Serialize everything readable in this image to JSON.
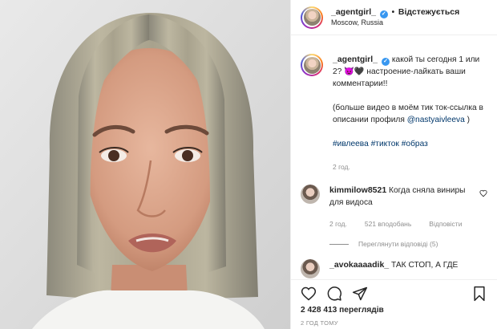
{
  "header": {
    "username": "_agentgirl_",
    "verified_badge": "✓",
    "separator": "•",
    "follow_state": "Відстежується",
    "location": "Moscow, Russia"
  },
  "caption": {
    "username": "_agentgirl_",
    "line1": "какой ты сегодня 1 или 2? 😈🖤 настроение-лайкать ваши комментарии!!",
    "line2": "(больше видео в моём тик ток-ссылка в описании профиля",
    "mention": "@nastyaivleeva",
    "line2_end": ")",
    "hashtags": [
      "#ивлеева",
      "#тикток",
      "#образ"
    ],
    "time": "2 год."
  },
  "comments": [
    {
      "username": "kimmilow8521",
      "text": "Когда сняла виниры для видоса",
      "time": "2 год.",
      "likes": "521 вподобань",
      "reply": "Відповісти",
      "view_replies": "Переглянути відповіді (5)"
    },
    {
      "username": "_avokaaaadik_",
      "text": "ТАК СТОП, А ГДЕ"
    }
  ],
  "footer": {
    "views": "2 428 413 переглядів",
    "timestamp": "2 ГОД ТОМУ"
  },
  "icons": {
    "verified": "verified-badge-icon",
    "like": "heart-icon",
    "comment": "comment-icon",
    "share": "share-icon",
    "save": "bookmark-icon"
  },
  "colors": {
    "link": "#00376b",
    "verified": "#3897f0",
    "muted": "#8e8e8e",
    "text": "#262626"
  }
}
